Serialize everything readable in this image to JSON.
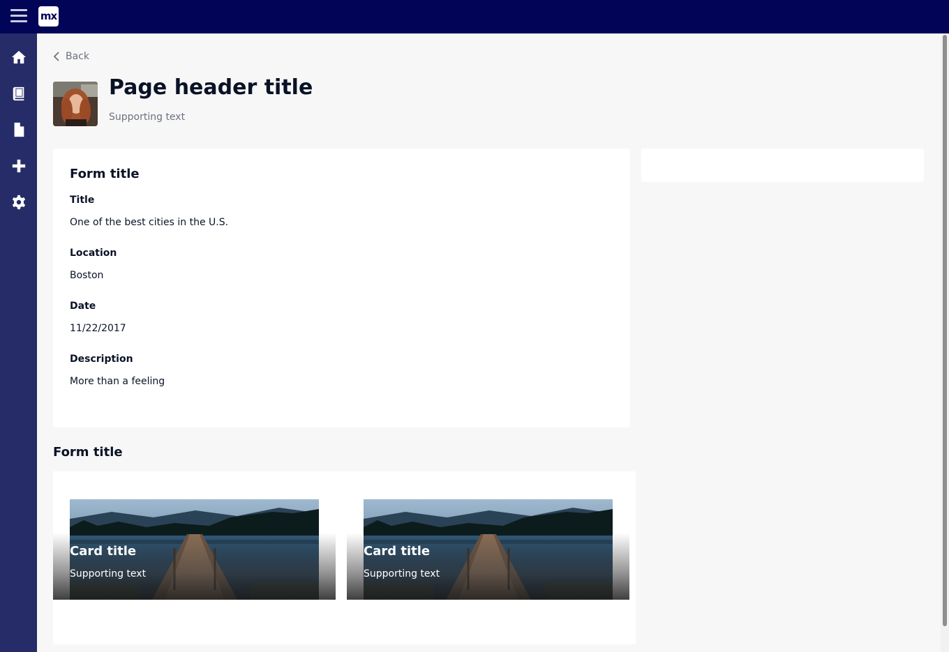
{
  "topbar": {
    "logo": "mx"
  },
  "sidebar": {
    "items": [
      {
        "icon": "home-icon"
      },
      {
        "icon": "book-icon"
      },
      {
        "icon": "file-icon"
      },
      {
        "icon": "plus-icon"
      },
      {
        "icon": "gear-icon"
      }
    ]
  },
  "header": {
    "back_label": "Back",
    "title": "Page header title",
    "subtitle": "Supporting text"
  },
  "form": {
    "title": "Form title",
    "fields": [
      {
        "label": "Title",
        "value": "One of the best cities in the U.S."
      },
      {
        "label": "Location",
        "value": "Boston"
      },
      {
        "label": "Date",
        "value": "11/22/2017"
      },
      {
        "label": "Description",
        "value": "More than a feeling"
      }
    ]
  },
  "cards_section": {
    "title": "Form title",
    "cards": [
      {
        "title": "Card title",
        "subtitle": "Supporting text"
      },
      {
        "title": "Card title",
        "subtitle": "Supporting text"
      }
    ]
  },
  "colors": {
    "topbar": "#020557",
    "sidebar": "#252c68",
    "background": "#f7f7f7"
  }
}
